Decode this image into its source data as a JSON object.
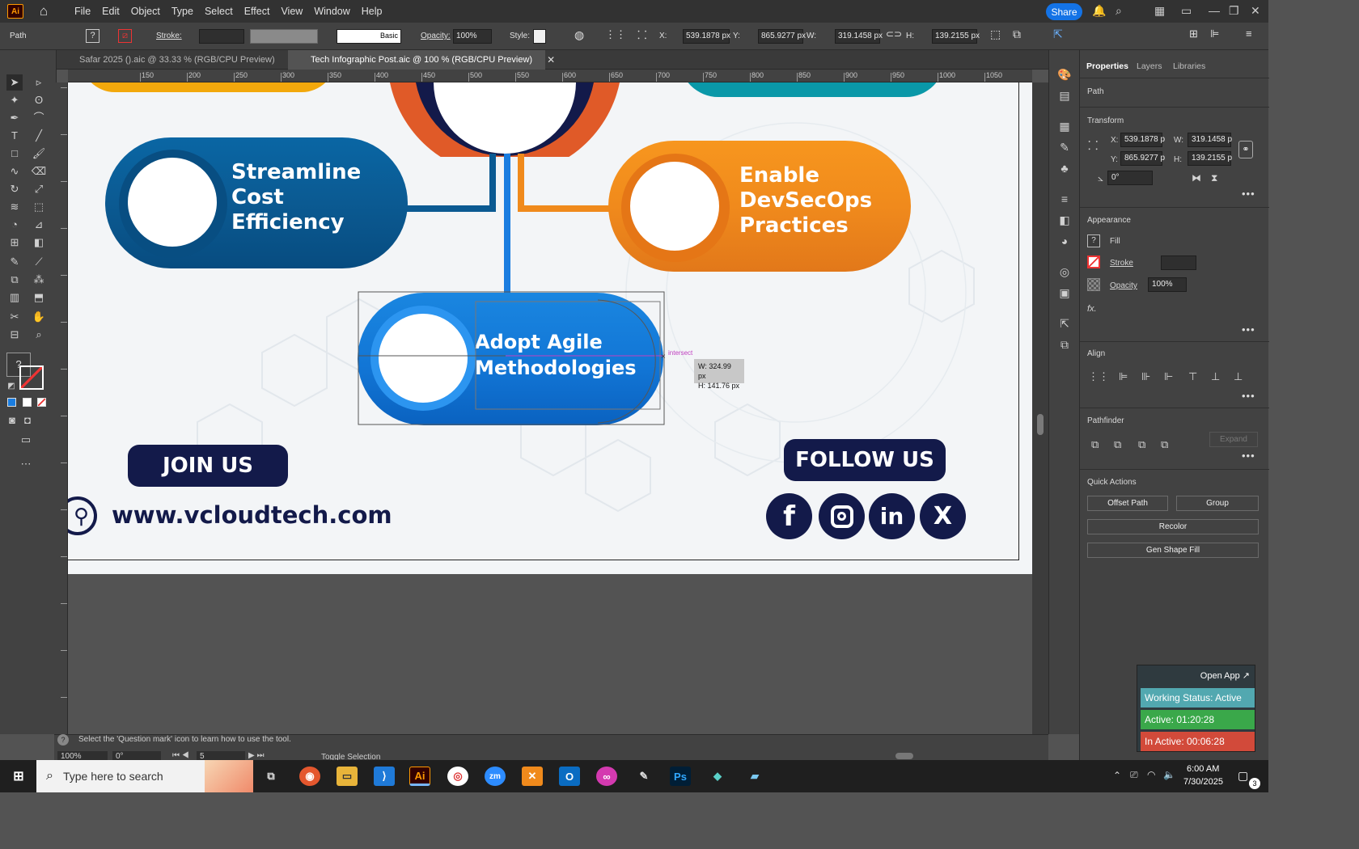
{
  "app": {
    "logo": "Ai",
    "menus": [
      "File",
      "Edit",
      "Object",
      "Type",
      "Select",
      "Effect",
      "View",
      "Window",
      "Help"
    ],
    "share": "Share"
  },
  "control": {
    "object_type": "Path",
    "stroke_label": "Stroke:",
    "line_style": "Basic",
    "opacity_label": "Opacity:",
    "opacity": "100%",
    "style_label": "Style:",
    "x_label": "X:",
    "x": "539.1878 px",
    "y_label": "Y:",
    "y": "865.9277 px",
    "w_label": "W:",
    "w": "319.1458 px",
    "h_label": "H:",
    "h": "139.2155 px"
  },
  "tabs": [
    {
      "label": "Safar 2025 ().aic @ 33.33 % (RGB/CPU Preview)"
    },
    {
      "label": "Tech Infographic Post.aic @ 100 % (RGB/CPU Preview)"
    }
  ],
  "ruler": {
    "h": [
      "150",
      "200",
      "250",
      "300",
      "350",
      "400",
      "450",
      "500",
      "550",
      "600",
      "650",
      "700",
      "750",
      "800",
      "850",
      "900",
      "950",
      "1000",
      "1050"
    ]
  },
  "artboard": {
    "pill_left": "Streamline Cost Efficiency",
    "pill_left_lines": [
      "Streamline",
      "Cost",
      "Efficiency"
    ],
    "pill_right_lines": [
      "Enable",
      "DevSecOps",
      "Practices"
    ],
    "pill_mid_lines": [
      "Adopt Agile",
      "Methodologies"
    ],
    "join": "JOIN US",
    "follow": "FOLLOW US",
    "url": "www.vcloudtech.com",
    "socials": [
      "f",
      "in",
      "X"
    ],
    "smart_guide": "intersect",
    "dim_w": "W: 324.99 px",
    "dim_h": "H: 141.76 px"
  },
  "panel": {
    "tabs": [
      "Properties",
      "Layers",
      "Libraries"
    ],
    "selection": "Path",
    "transform": {
      "title": "Transform",
      "x_label": "X:",
      "x": "539.1878 p",
      "y_label": "Y:",
      "y": "865.9277 p",
      "w_label": "W:",
      "w": "319.1458 p",
      "h_label": "H:",
      "h": "139.2155 p",
      "angle": "0°"
    },
    "appearance": {
      "title": "Appearance",
      "fill": "Fill",
      "stroke": "Stroke",
      "opacity_label": "Opacity",
      "opacity": "100%",
      "fx": "fx."
    },
    "align": "Align",
    "pathfinder": "Pathfinder",
    "expand": "Expand",
    "quick_actions": {
      "title": "Quick Actions",
      "offset": "Offset Path",
      "group": "Group",
      "recolor": "Recolor",
      "gen_fill": "Gen Shape Fill"
    }
  },
  "status": {
    "zoom": "100%",
    "angle": "0°",
    "artboard": "5",
    "toggle": "Toggle Selection",
    "hint": "Select the 'Question mark' icon to learn how to use the tool."
  },
  "tracker": {
    "open": "Open App ↗",
    "working": "Working Status: Active",
    "active": "Active: 01:20:28",
    "inactive": "In Active: 00:06:28"
  },
  "taskbar": {
    "search": "Type here to search",
    "time": "6:00 AM",
    "date": "7/30/2025",
    "notif": "3"
  },
  "colors": {
    "accent": "#1473e6",
    "navy": "#131a4a",
    "orange": "#f08a1c",
    "blue_dark": "#0b5a92",
    "blue_mid": "#1276d6"
  }
}
